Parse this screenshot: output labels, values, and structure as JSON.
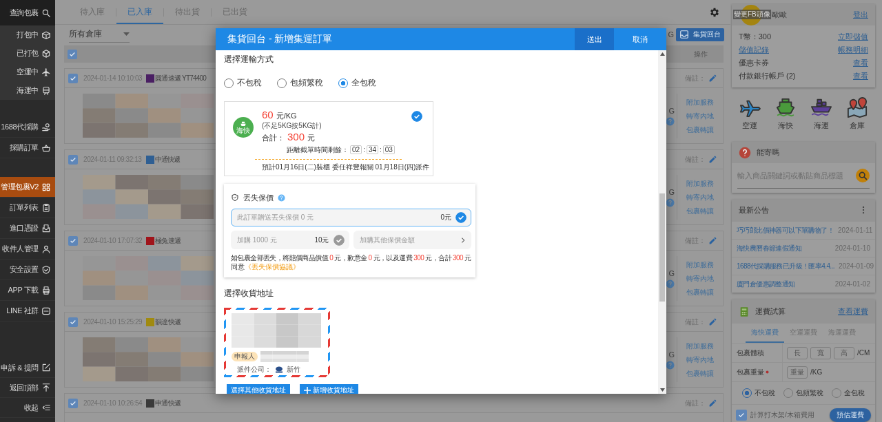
{
  "sidebar": {
    "sections": [
      {
        "kind": "search",
        "items": [
          {
            "label": "查詢包裹",
            "selected": false
          }
        ]
      },
      {
        "kind": "status",
        "items": [
          {
            "label": "打包中",
            "selected": false
          },
          {
            "label": "已打包",
            "selected": false
          },
          {
            "label": "空運中",
            "selected": false
          },
          {
            "label": "海運中",
            "selected": false
          }
        ]
      },
      {
        "kind": "purchase",
        "items": [
          {
            "label": "1688代採購",
            "selected": false
          },
          {
            "label": "採購訂單",
            "selected": false
          }
        ]
      },
      {
        "kind": "manage",
        "items": [
          {
            "label": "管理包裹V2",
            "selected": true
          },
          {
            "label": "訂單列表",
            "selected": false
          },
          {
            "label": "進口憑證",
            "selected": false
          },
          {
            "label": "收件人管理",
            "selected": false
          },
          {
            "label": "安全設置",
            "selected": false
          },
          {
            "label": "APP 下載",
            "selected": false
          },
          {
            "label": "LINE 社群",
            "selected": false
          }
        ]
      },
      {
        "kind": "footer",
        "items": [
          {
            "label": "申訴 & 提問",
            "selected": false
          },
          {
            "label": "返回頂部",
            "selected": false
          },
          {
            "label": "收起",
            "selected": false
          }
        ]
      }
    ]
  },
  "main": {
    "tabs": [
      {
        "label": "待入庫",
        "selected": false
      },
      {
        "label": "已入庫",
        "selected": true
      },
      {
        "label": "待出貨",
        "selected": false
      },
      {
        "label": "已出貨",
        "selected": false
      }
    ],
    "warehouse_select": "所有倉庫",
    "cut_text": "G",
    "collect_button": "集貨回台",
    "select_all": true,
    "actions_heading": "操作",
    "packages": [
      {
        "checked": true,
        "time": "2024-01-14 10:10:03",
        "color": "#4a1f63",
        "courier": "圓通速遞 YT74400",
        "note_label": "備註：",
        "cut_text": "G",
        "actions": [
          "附加服務",
          "轉寄內地",
          "包裹轉讓"
        ]
      },
      {
        "checked": true,
        "time": "2024-01-11 09:32:13",
        "color": "#2f5f93",
        "courier": "中通快遞",
        "note_label": "備註：",
        "cut_text": "G",
        "actions": [
          "附加服務",
          "轉寄內地",
          "包裹轉讓"
        ]
      },
      {
        "checked": true,
        "time": "2024-01-10 17:07:32",
        "color": "#a0141b",
        "courier": "極兔速遞",
        "note_label": "備註：",
        "cut_text": "G",
        "actions": [
          "附加服務",
          "轉寄內地",
          "包裹轉讓"
        ]
      },
      {
        "checked": true,
        "time": "2024-01-10 15:25:29",
        "color": "#a08a10",
        "courier": "韻達快遞",
        "note_label": "備註：",
        "cut_text": "G",
        "actions": [
          "附加服務",
          "轉寄內地",
          "包裹轉讓"
        ]
      },
      {
        "checked": true,
        "time": "2024-01-10 10:26:54",
        "color": "#3a3a3a",
        "courier": "申通快遞",
        "note_label": "備註："
      }
    ]
  },
  "account": {
    "avatar_caption": "變更FB頭像",
    "name": "歐歐",
    "logout": "登出",
    "balance": "T幣：300",
    "topup": "立即儲值",
    "links": [
      "儲值記錄",
      "帳務明細"
    ],
    "rows": [
      {
        "label": "優惠卡券",
        "action": "查看"
      },
      {
        "label": "付款銀行帳戶 (2)",
        "action": "查看"
      }
    ]
  },
  "shipping_modes": [
    {
      "label": "空運"
    },
    {
      "label": "海快"
    },
    {
      "label": "海運"
    },
    {
      "label": "倉庫"
    }
  ],
  "can_ship": {
    "title": "能寄嗎",
    "search_placeholder": "輸入商品關鍵詞或黏貼商品標題"
  },
  "announcements": {
    "title": "最新公告",
    "items": [
      {
        "title": "巧巧郎比價神器可以下單購物了！",
        "date": "2024-01-11"
      },
      {
        "title": "海快農曆春節連假通知",
        "date": "2024-01-10"
      },
      {
        "title": "1688代採購服務已升級！匯率4.4...",
        "date": "2024-01-09"
      },
      {
        "title": "廈門倉優惠調整通知",
        "date": "2024-01-02"
      }
    ]
  },
  "calculator": {
    "title": "運費試算",
    "link": "查看運費",
    "tabs": [
      {
        "label": "海快運費",
        "selected": true
      },
      {
        "label": "空運運費",
        "selected": false
      },
      {
        "label": "海運運費",
        "selected": false
      }
    ],
    "rows": [
      {
        "label": "包裹體積",
        "required": false,
        "placeholders": [
          "長",
          "寬",
          "高"
        ],
        "unit": "/CM"
      },
      {
        "label": "包裹重量",
        "required": true,
        "placeholders": [
          "重量"
        ],
        "unit": "/KG"
      }
    ],
    "tax_options": [
      {
        "label": "不包稅",
        "selected": true
      },
      {
        "label": "包頻繁稅",
        "selected": false
      },
      {
        "label": "全包稅",
        "selected": false
      }
    ],
    "wood_frame": {
      "label": "計算打木架/木箱費用",
      "checked": true
    },
    "estimate_button": "預估運費"
  },
  "modal": {
    "title": "集貨回台 - 新增集運訂單",
    "buttons": [
      {
        "label": "送出",
        "primary": true
      },
      {
        "label": "取消",
        "primary": false
      }
    ],
    "transport_heading": "選擇運輸方式",
    "tax_options": [
      {
        "label": "不包稅",
        "selected": false
      },
      {
        "label": "包頻繁稅",
        "selected": false
      },
      {
        "label": "全包稅",
        "selected": true
      }
    ],
    "plan": {
      "badge": "海快",
      "price": "60",
      "price_unit": "元/KG",
      "min_note": "(不足5KG按5KG計)",
      "total_label": "合計：",
      "total": "300",
      "total_unit": "元",
      "countdown_label": "距離截單時間剩餘：",
      "countdown": [
        {
          "kind": "digits",
          "text": "02"
        },
        {
          "kind": "sep",
          "text": ":"
        },
        {
          "kind": "digits",
          "text": "34"
        },
        {
          "kind": "sep",
          "text": ":"
        },
        {
          "kind": "digits",
          "text": "03"
        }
      ],
      "schedule": "預計01月16日(二)裝櫃 委任祥豐報關 01月18日(四)派件",
      "selected": true
    },
    "insurance": {
      "title": "丟失保價",
      "options": [
        {
          "kind": "field",
          "label": "此訂單贈送丟失保價 0 元",
          "price": "0元",
          "selected": true
        },
        {
          "kind": "tile",
          "label": "加購 1000 元",
          "price": "10元",
          "selected": false
        },
        {
          "kind": "link",
          "label": "加購其他保價金額",
          "selected": false
        }
      ],
      "note": [
        {
          "text": "如包裹全部丟失，將賠償商品價值 ",
          "highlight": false
        },
        {
          "text": "0",
          "highlight": true
        },
        {
          "text": " 元，歉意金 ",
          "highlight": false
        },
        {
          "text": "0",
          "highlight": true
        },
        {
          "text": " 元，以及運費 ",
          "highlight": false
        },
        {
          "text": "300",
          "highlight": true
        },
        {
          "text": " 元，合計 ",
          "highlight": false
        },
        {
          "text": "300",
          "highlight": true
        },
        {
          "text": " 元",
          "highlight": false
        }
      ],
      "agree_label": "同意",
      "agreement_link": "《丟失保價協議》"
    },
    "address_heading": "選擇收貨地址",
    "address": {
      "tag": "申報人",
      "company_label": "派件公司：",
      "company": "新竹"
    },
    "address_buttons": [
      {
        "label": "選擇其他收貨地址",
        "kind": "plain"
      },
      {
        "label": "新增收貨地址",
        "kind": "add"
      }
    ]
  }
}
